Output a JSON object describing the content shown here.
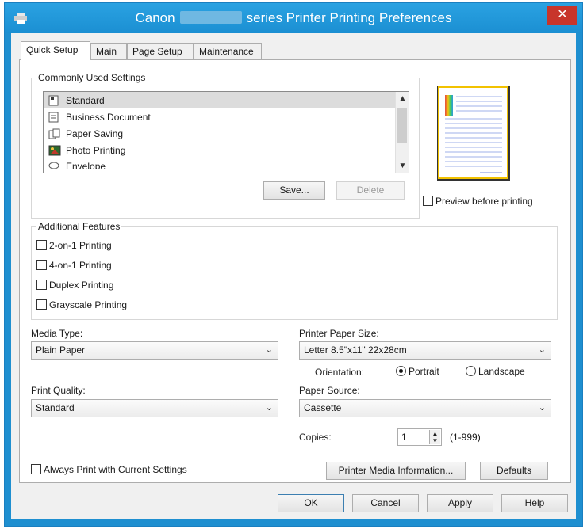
{
  "window": {
    "title_left": "Canon",
    "title_right": "series Printer Printing Preferences",
    "close_label": "✕"
  },
  "tabs": [
    {
      "label": "Quick Setup"
    },
    {
      "label": "Main"
    },
    {
      "label": "Page Setup"
    },
    {
      "label": "Maintenance"
    }
  ],
  "common_settings": {
    "title": "Commonly Used Settings",
    "items": [
      {
        "label": "Standard",
        "icon": "standard-icon"
      },
      {
        "label": "Business Document",
        "icon": "document-icon"
      },
      {
        "label": "Paper Saving",
        "icon": "paper-saving-icon"
      },
      {
        "label": "Photo Printing",
        "icon": "photo-icon"
      },
      {
        "label": "Envelope",
        "icon": "envelope-icon"
      }
    ],
    "save_label": "Save...",
    "delete_label": "Delete"
  },
  "preview_label": "Preview before printing",
  "additional": {
    "title": "Additional Features",
    "options": [
      {
        "label": "2-on-1 Printing"
      },
      {
        "label": "4-on-1 Printing"
      },
      {
        "label": "Duplex Printing"
      },
      {
        "label": "Grayscale Printing"
      }
    ]
  },
  "media_type": {
    "label": "Media Type:",
    "value": "Plain Paper"
  },
  "paper_size": {
    "label": "Printer Paper Size:",
    "value": "Letter 8.5\"x11\" 22x28cm"
  },
  "orientation": {
    "label": "Orientation:",
    "portrait": "Portrait",
    "landscape": "Landscape"
  },
  "print_quality": {
    "label": "Print Quality:",
    "value": "Standard"
  },
  "paper_source": {
    "label": "Paper Source:",
    "value": "Cassette"
  },
  "copies": {
    "label": "Copies:",
    "value": "1",
    "range": "(1-999)"
  },
  "always_print_label": "Always Print with Current Settings",
  "media_info_label": "Printer Media Information...",
  "defaults_label": "Defaults",
  "footer": {
    "ok": "OK",
    "cancel": "Cancel",
    "apply": "Apply",
    "help": "Help"
  }
}
